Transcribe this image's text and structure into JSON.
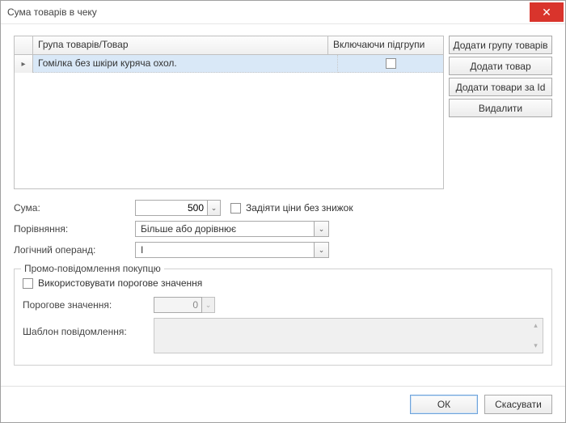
{
  "window": {
    "title": "Сума товарів в чеку"
  },
  "grid": {
    "header": {
      "col1": "Група товарів/Товар",
      "col2": "Включаючи підгрупи"
    },
    "rows": [
      {
        "name": "Гомілка без шкіри куряча охол.",
        "include_subgroups": false,
        "selected": true
      }
    ]
  },
  "side_buttons": {
    "add_group": "Додати групу товарів",
    "add_item": "Додати товар",
    "add_by_id": "Додати товари за Id",
    "delete": "Видалити"
  },
  "form": {
    "sum_label": "Сума:",
    "sum_value": "500",
    "prices_no_discount_checked": false,
    "prices_no_discount_label": "Задіяти ціни без знижок",
    "compare_label": "Порівняння:",
    "compare_value": "Більше або дорівнює",
    "operand_label": "Логічний операнд:",
    "operand_value": "І"
  },
  "promo": {
    "legend": "Промо-повідомлення покупцю",
    "use_threshold_checked": false,
    "use_threshold_label": "Використовувати порогове значення",
    "threshold_label": "Порогове значення:",
    "threshold_value": "0",
    "template_label": "Шаблон повідомлення:",
    "template_value": ""
  },
  "footer": {
    "ok": "ОК",
    "cancel": "Скасувати"
  }
}
